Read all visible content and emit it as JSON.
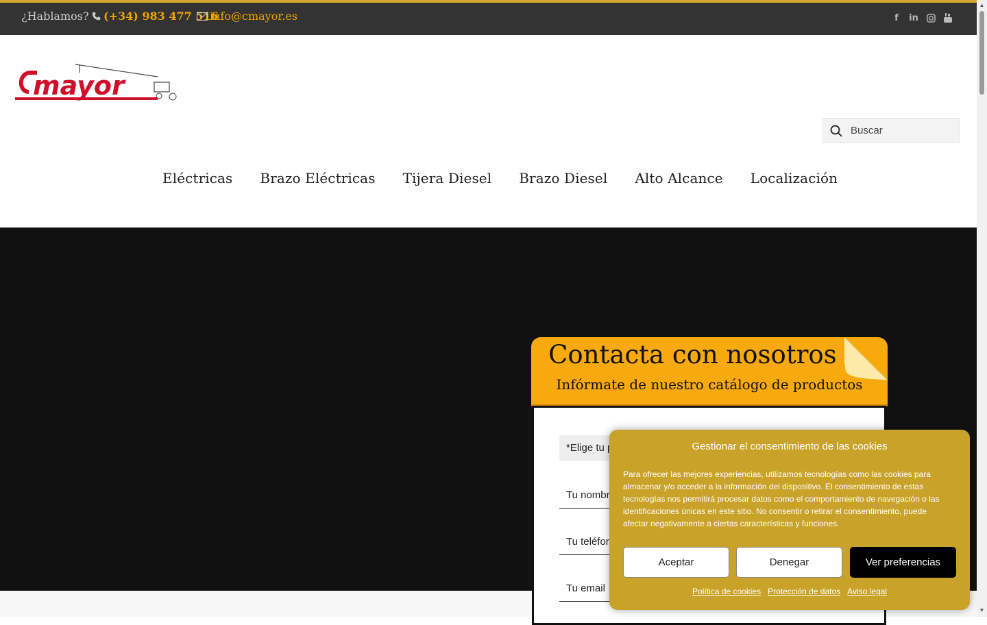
{
  "topbar": {
    "greeting": "¿Hablamos?",
    "phone": "(+34) 983 477 516",
    "email": "info@cmayor.es",
    "social": [
      "facebook-icon",
      "linkedin-icon",
      "instagram-icon",
      "youtube-icon"
    ]
  },
  "logo": {
    "text": "Cmayor"
  },
  "search": {
    "placeholder": "Buscar"
  },
  "nav": {
    "items": [
      "Eléctricas",
      "Brazo Eléctricas",
      "Tijera Diesel",
      "Brazo Diesel",
      "Alto Alcance",
      "Localización"
    ]
  },
  "contact": {
    "title": "Contacta con nosotros :",
    "subtitle": "Infórmate de nuestro catálogo de productos",
    "select_label": "*Elige tu p",
    "name_placeholder": "Tu nombr",
    "phone_placeholder": "Tu teléfor",
    "email_placeholder": "Tu email"
  },
  "cookie": {
    "title": "Gestionar el consentimiento de las cookies",
    "body": "Para ofrecer las mejores experiencias, utilizamos tecnologías como las cookies para almacenar y/o acceder a la información del dispositivo. El consentimiento de estas tecnologías nos permitirá procesar datos como el comportamiento de navegación o las identificaciones únicas en este sitio. No consentir o retirar el consentimiento, puede afectar negativamente a ciertas características y funciones.",
    "accept": "Aceptar",
    "deny": "Denegar",
    "preferences": "Ver preferencias",
    "links": [
      "Política de cookies",
      "Protección de datos",
      "Aviso legal"
    ]
  },
  "colors": {
    "accent": "#f0a500",
    "topbar": "#333333",
    "cookie_bg": "#c9a229",
    "hero_bg": "#111111"
  }
}
